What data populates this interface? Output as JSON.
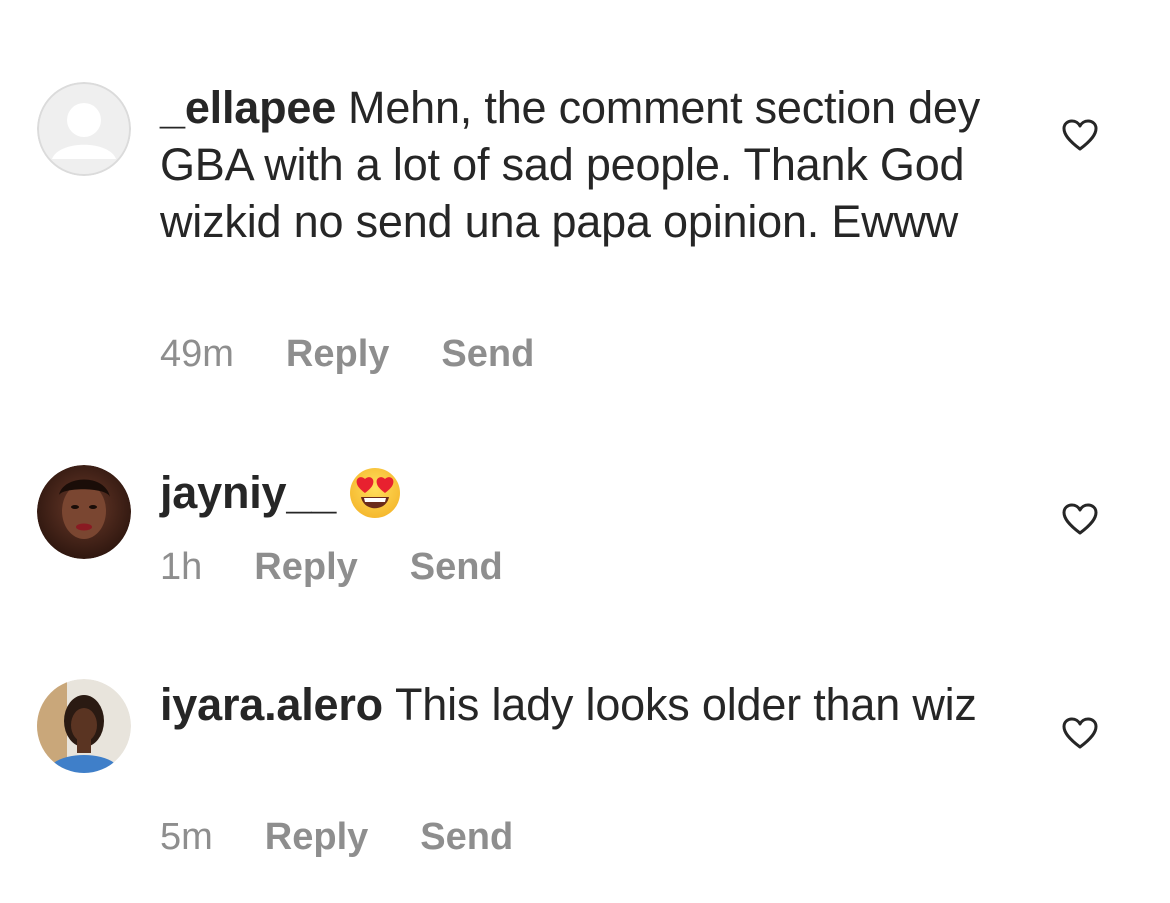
{
  "comments": [
    {
      "username": "_ellapee",
      "text": "Mehn, the comment section dey GBA with a lot of sad people. Thank God wizkid no send una papa opinion. Ewww",
      "time": "49m",
      "reply_label": "Reply",
      "send_label": "Send",
      "avatar": "default-profile-avatar"
    },
    {
      "username": "jayniy__",
      "text": "",
      "emoji": "heart-eyes-emoji",
      "time": "1h",
      "reply_label": "Reply",
      "send_label": "Send",
      "avatar": "profile-photo"
    },
    {
      "username": "iyara.alero",
      "text": "This lady looks older than wiz",
      "time": "5m",
      "reply_label": "Reply",
      "send_label": "Send",
      "avatar": "profile-photo"
    }
  ],
  "colors": {
    "text": "#262626",
    "secondary": "#8e8e8e",
    "background": "#ffffff"
  },
  "icons": {
    "like": "heart-outline-icon"
  }
}
